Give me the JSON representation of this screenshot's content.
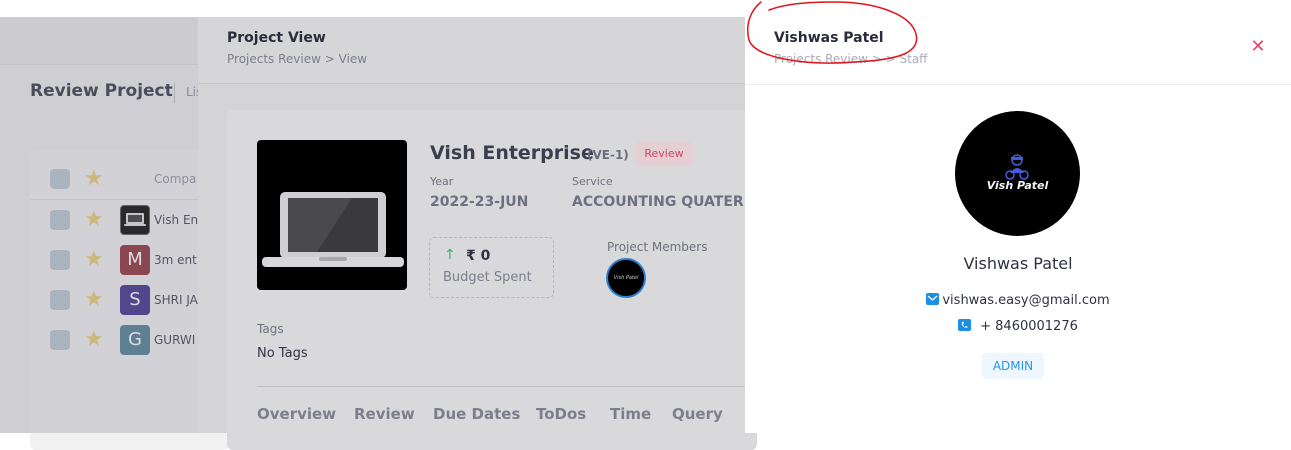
{
  "background_page": {
    "title": "Review Project",
    "subtitle": "Lis",
    "column_header": "Compa",
    "rows": [
      {
        "avatar_letter": "",
        "avatar_color": "#000000",
        "name": "Vish En"
      },
      {
        "avatar_letter": "M",
        "avatar_color": "#8b2a33",
        "name": "3m ent"
      },
      {
        "avatar_letter": "S",
        "avatar_color": "#3a2a8a",
        "name": "SHRI JA"
      },
      {
        "avatar_letter": "G",
        "avatar_color": "#4a7b96",
        "name": "GURWI"
      }
    ]
  },
  "project_view": {
    "title": "Project View",
    "breadcrumb": "Projects Review  >  View",
    "project_name": "Vish Enterprise",
    "project_code": "(VE-1)",
    "status_badge": "Review",
    "year_label": "Year",
    "year_value": "2022-23-JUN",
    "service_label": "Service",
    "service_value": "ACCOUNTING QUATERLY",
    "budget_value": "₹ 0",
    "budget_label": "Budget Spent",
    "members_label": "Project Members",
    "member_avatar_text": "Vish Patel",
    "tags_label": "Tags",
    "tags_value": "No Tags",
    "tabs": [
      "Overview",
      "Review",
      "Due Dates",
      "ToDos",
      "Time",
      "Query"
    ]
  },
  "drawer": {
    "title": "Vishwas Patel",
    "breadcrumb": "Projects Review  >          >  Staff",
    "close_icon": "close-icon",
    "avatar_text": "Vish Patel",
    "name": "Vishwas Patel",
    "email": "vishwas.easy@gmail.com",
    "phone": "+ 8460001276",
    "role": "ADMIN",
    "colors": {
      "accent": "#1a8fe3",
      "close": "#e2476b",
      "annotation": "#e0141e"
    }
  }
}
